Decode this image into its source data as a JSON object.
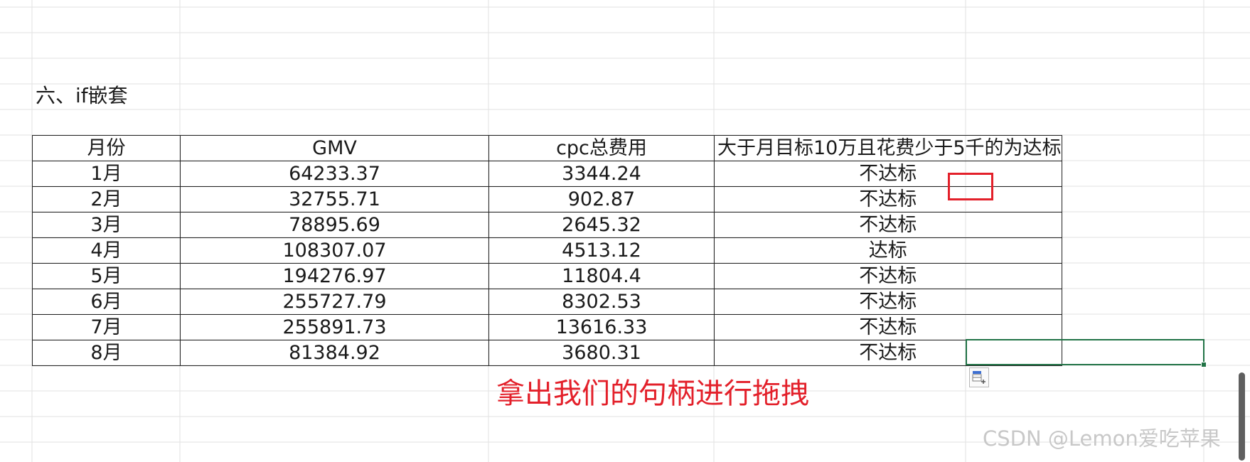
{
  "section_title": "六、if嵌套",
  "table": {
    "headers": [
      "月份",
      "GMV",
      "cpc总费用",
      "大于月目标10万且花费少于5千的为达标"
    ],
    "rows": [
      [
        "1月",
        "64233.37",
        "3344.24",
        "不达标"
      ],
      [
        "2月",
        "32755.71",
        "902.87",
        "不达标"
      ],
      [
        "3月",
        "78895.69",
        "2645.32",
        "不达标"
      ],
      [
        "4月",
        "108307.07",
        "4513.12",
        "达标"
      ],
      [
        "5月",
        "194276.97",
        "11804.4",
        "不达标"
      ],
      [
        "6月",
        "255727.79",
        "8302.53",
        "不达标"
      ],
      [
        "7月",
        "255891.73",
        "13616.33",
        "不达标"
      ],
      [
        "8月",
        "81384.92",
        "3680.31",
        "不达标"
      ]
    ]
  },
  "annotation": "拿出我们的句柄进行拖拽",
  "watermark": "CSDN @Lemon爱吃苹果",
  "colors": {
    "annotation_red": "#e3202a",
    "selection_green": "#217346",
    "gridline": "#e2e2e2"
  },
  "icons": {
    "autofill_options": "autofill-options-icon",
    "fill_handle": "fill-handle"
  }
}
